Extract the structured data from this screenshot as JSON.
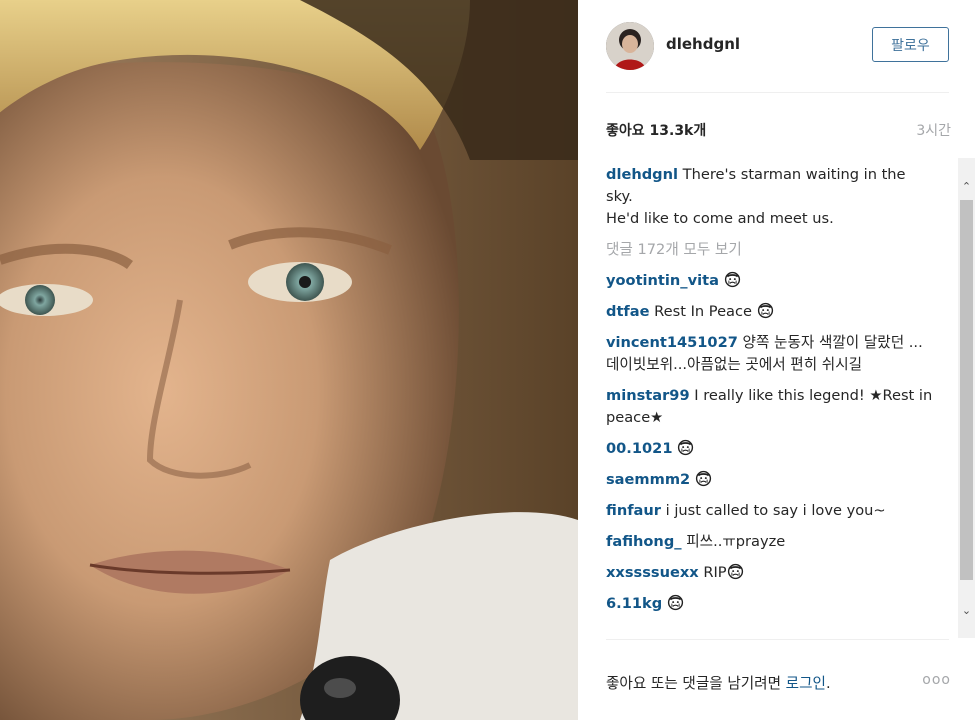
{
  "post": {
    "image_alt": "portrait photo"
  },
  "header": {
    "username": "dlehdgnl",
    "follow_label": "팔로우"
  },
  "stats": {
    "likes": "좋아요 13.3k개",
    "time": "3시간"
  },
  "caption": {
    "user": "dlehdgnl",
    "text": " There's starman waiting in the sky.",
    "text2": "He'd like to come and meet us."
  },
  "view_all": "댓글 172개 모두 보기",
  "comments": [
    {
      "user": "yootintin_vita",
      "text": " ",
      "emoji": true
    },
    {
      "user": "dtfae",
      "text": " Rest In Peace ",
      "emoji": true
    },
    {
      "user": "vincent1451027",
      "text": " 양쪽 눈동자 색깔이 달랐던 ...데이빗보위...아픔없는 곳에서 편히 쉬시길",
      "emoji": false
    },
    {
      "user": "minstar99",
      "text": " I really like this legend! ★Rest in peace★",
      "emoji": false
    },
    {
      "user": "00.1021",
      "text": " ",
      "emoji": true
    },
    {
      "user": "saemmm2",
      "text": " ",
      "emoji": true
    },
    {
      "user": "finfaur",
      "text": " i just called to say i love you~",
      "emoji": false
    },
    {
      "user": "fafihong_",
      "text": " 피쓰..ㅠprayze",
      "emoji": false
    },
    {
      "user": "xxssssuexx",
      "text": " RIP",
      "emoji": true
    },
    {
      "user": "6.11kg",
      "text": " ",
      "emoji": true
    }
  ],
  "footer": {
    "prefix": "좋아요 또는 댓글을 남기려면 ",
    "login": "로그인",
    "suffix": ".",
    "more": "ooo"
  },
  "icons": {
    "emoji": "crying-face-icon",
    "more": "more-options-icon",
    "scroll_up": "chevron-up-icon",
    "scroll_down": "chevron-down-icon"
  },
  "colors": {
    "link": "#125688",
    "follow": "#3f729b",
    "muted": "#a5a7aa"
  }
}
